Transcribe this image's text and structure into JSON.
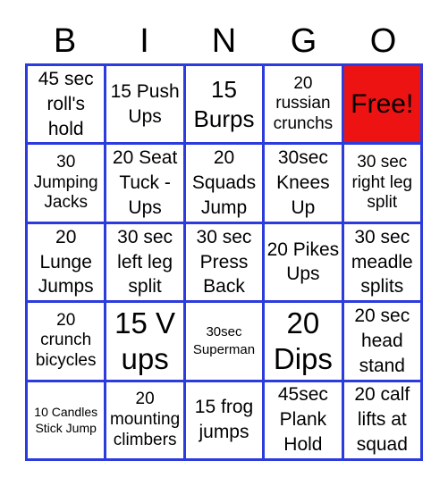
{
  "header": {
    "letters": [
      "B",
      "I",
      "N",
      "G",
      "O"
    ]
  },
  "colors": {
    "grid_border": "#2b3bdc",
    "free_space": "#ed1313",
    "cell_background": "#ffffff",
    "text": "#000000"
  },
  "card": {
    "rows": [
      [
        {
          "text": "45 sec roll's hold",
          "free": false
        },
        {
          "text": "15 Push Ups",
          "free": false
        },
        {
          "text": "15 Burps",
          "free": false
        },
        {
          "text": "20 russian crunchs",
          "free": false
        },
        {
          "text": "Free!",
          "free": true
        }
      ],
      [
        {
          "text": "30 Jumping Jacks",
          "free": false
        },
        {
          "text": "20 Seat Tuck - Ups",
          "free": false
        },
        {
          "text": "20 Squads Jump",
          "free": false
        },
        {
          "text": "30sec Knees Up",
          "free": false
        },
        {
          "text": "30 sec right leg split",
          "free": false
        }
      ],
      [
        {
          "text": "20 Lunge Jumps",
          "free": false
        },
        {
          "text": "30 sec left leg split",
          "free": false
        },
        {
          "text": "30 sec Press Back",
          "free": false
        },
        {
          "text": "20 Pikes Ups",
          "free": false
        },
        {
          "text": "30 sec meadle splits",
          "free": false
        }
      ],
      [
        {
          "text": "20 crunch bicycles",
          "free": false
        },
        {
          "text": "15 V ups",
          "free": false
        },
        {
          "text": "30sec Superman",
          "free": false
        },
        {
          "text": "20 Dips",
          "free": false
        },
        {
          "text": "20 sec head stand",
          "free": false
        }
      ],
      [
        {
          "text": "10 Candles Stick Jump",
          "free": false
        },
        {
          "text": "20 mounting climbers",
          "free": false
        },
        {
          "text": "15 frog jumps",
          "free": false
        },
        {
          "text": "45sec Plank Hold",
          "free": false
        },
        {
          "text": "20 calf lifts at squad",
          "free": false
        }
      ]
    ]
  }
}
